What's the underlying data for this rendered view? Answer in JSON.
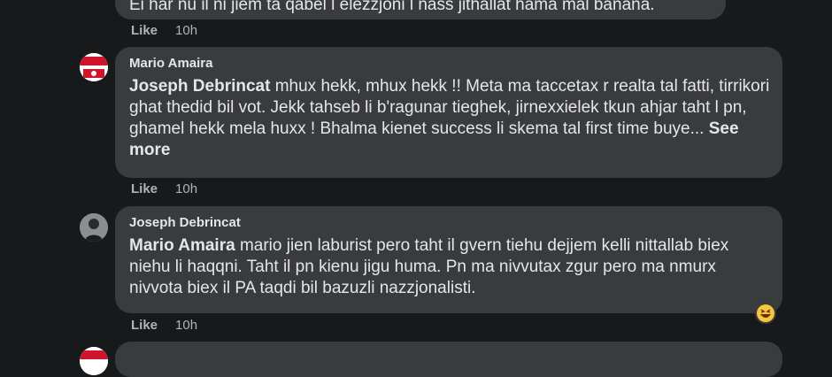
{
  "comments": [
    {
      "text": "Ei har nu il ni jiem ta qabel l elezzjoni l nass jithallat hama mal banana.",
      "like_label": "Like",
      "time": "10h"
    },
    {
      "author": "Mario Amaira",
      "mention": "Joseph Debrincat",
      "text": " mhux hekk, mhux hekk !! Meta ma taccetax r realta tal fatti, tirrikori ghat thedid bil vot. Jekk tahseb li b'ragunar tieghek, jirnexxielek tkun ahjar taht l pn, ghamel hekk mela huxx ! Bhalma kienet success li skema tal first time buye...",
      "see_more": "See more",
      "like_label": "Like",
      "time": "10h",
      "avatar_icon": "maltese-flag-avatar"
    },
    {
      "author": "Joseph Debrincat",
      "mention": "Mario Amaira",
      "text": " mario jien laburist pero taht il gvern tiehu dejjem kelli nittallab biex niehu li haqqni. Taht il pn kienu jigu huma. Pn ma nivvutax zgur pero ma nmurx nivvota biex il PA taqdi bil bazuzli nazzjonalisti.",
      "like_label": "Like",
      "time": "10h",
      "reaction_icon": "laughing-emoji-icon"
    }
  ]
}
